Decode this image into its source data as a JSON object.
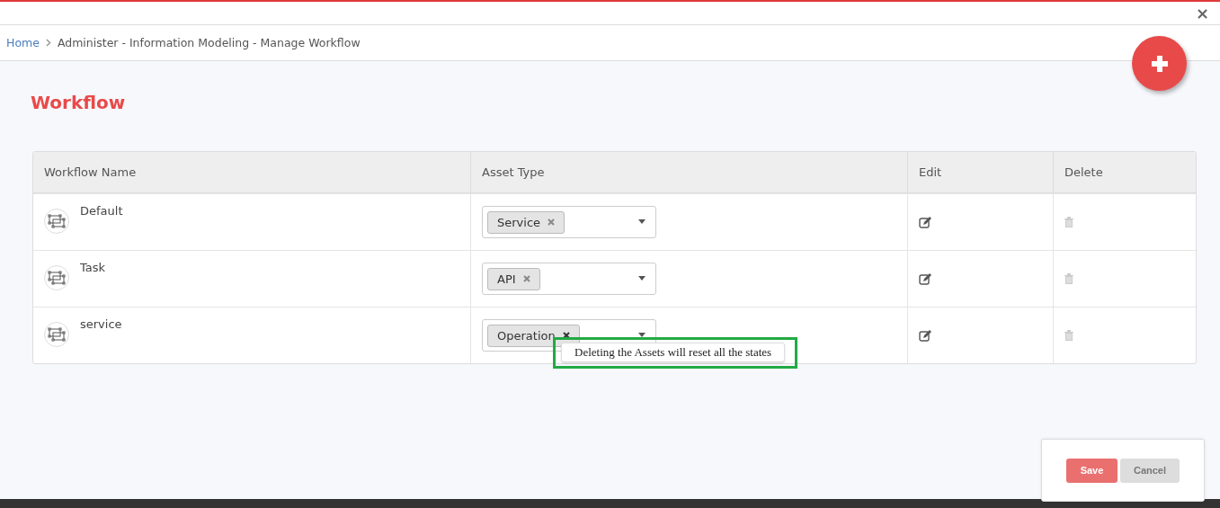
{
  "close_icon": "×",
  "breadcrumb": {
    "home": "Home",
    "path": "Administer - Information Modeling - Manage Workflow"
  },
  "title": "Workflow",
  "table": {
    "columns": [
      "Workflow Name",
      "Asset Type",
      "Edit",
      "Delete"
    ],
    "rows": [
      {
        "name": "Default",
        "tags": [
          "Service"
        ]
      },
      {
        "name": "Task",
        "tags": [
          "API"
        ]
      },
      {
        "name": "service",
        "tags": [
          "Operation"
        ],
        "tooltip": "Deleting the Assets will reset all the states"
      }
    ]
  },
  "actions": [
    {
      "label": "Save",
      "kind": "primary",
      "disabled": true
    },
    {
      "label": "Cancel",
      "kind": "secondary",
      "disabled": true
    }
  ]
}
